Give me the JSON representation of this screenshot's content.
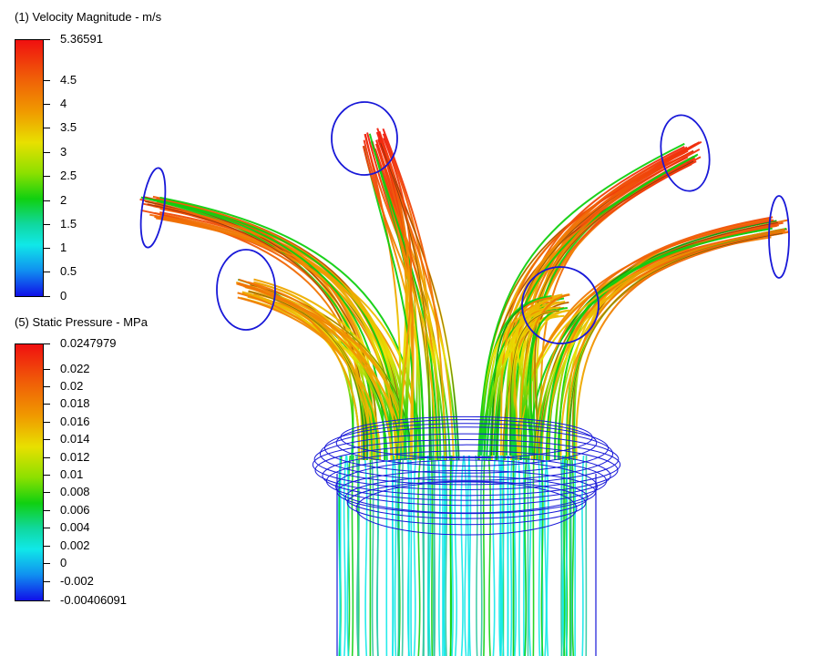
{
  "legends": [
    {
      "title": "(1) Velocity Magnitude - m/s",
      "ticks": [
        "5.36591",
        "4.5",
        "4",
        "3.5",
        "3",
        "2.5",
        "2",
        "1.5",
        "1",
        "0.5",
        "0"
      ]
    },
    {
      "title": "(5) Static Pressure - MPa",
      "ticks": [
        "0.0247979",
        "0.022",
        "0.02",
        "0.018",
        "0.016",
        "0.014",
        "0.012",
        "0.01",
        "0.008",
        "0.006",
        "0.004",
        "0.002",
        "0",
        "-0.002",
        "-0.00406091"
      ]
    }
  ],
  "colors": {
    "high": "#f01010",
    "mid_high": "#f09a00",
    "mid": "#e8e000",
    "mid_low": "#10d010",
    "low_mid": "#10e8e8",
    "low": "#1010e8",
    "outline": "#1818d8"
  }
}
